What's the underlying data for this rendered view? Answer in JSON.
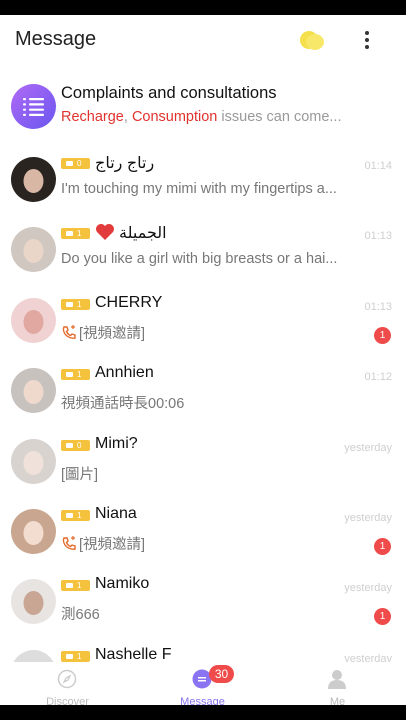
{
  "header": {
    "title": "Message"
  },
  "complaints": {
    "title": "Complaints and consultations",
    "sub_red1": "Recharge",
    "sub_sep": ", ",
    "sub_red2": "Consumption",
    "sub_rest": " issues can come..."
  },
  "conversations": [
    {
      "name": "رتاج رتاج",
      "level": "0",
      "message": "I'm touching my mimi with my fingertips a...",
      "time": "01:14",
      "unread": "",
      "heart": false,
      "call": false
    },
    {
      "name": "الجميلة",
      "level": "1",
      "message": "Do you like a girl with big breasts or a hai...",
      "time": "01:13",
      "unread": "",
      "heart": true,
      "call": false
    },
    {
      "name": "CHERRY",
      "level": "1",
      "message": "[視頻邀請]",
      "time": "01:13",
      "unread": "1",
      "heart": false,
      "call": true
    },
    {
      "name": "Annhien",
      "level": "1",
      "message": "視頻通話時長00:06",
      "time": "01:12",
      "unread": "",
      "heart": false,
      "call": false
    },
    {
      "name": "Mimi?",
      "level": "0",
      "message": "[圖片]",
      "time": "yesterday",
      "unread": "",
      "heart": false,
      "call": false
    },
    {
      "name": "Niana",
      "level": "1",
      "message": "[視頻邀請]",
      "time": "yesterday",
      "unread": "1",
      "heart": false,
      "call": true
    },
    {
      "name": "Namiko",
      "level": "1",
      "message": "測666",
      "time": "yesterday",
      "unread": "1",
      "heart": false,
      "call": false
    },
    {
      "name": "Nashelle F",
      "level": "1",
      "message": "",
      "time": "yesterday",
      "unread": "",
      "heart": false,
      "call": false
    }
  ],
  "tabs": [
    {
      "label": "Discover",
      "icon": "compass-icon",
      "active": false
    },
    {
      "label": "Message",
      "icon": "chat-icon",
      "active": true,
      "badge": "30"
    },
    {
      "label": "Me",
      "icon": "person-icon",
      "active": false
    }
  ],
  "colors": {
    "accent": "#8a74f2",
    "red": "#e0332e",
    "badge": "#ef4b4b",
    "level": "#f5c23e"
  }
}
